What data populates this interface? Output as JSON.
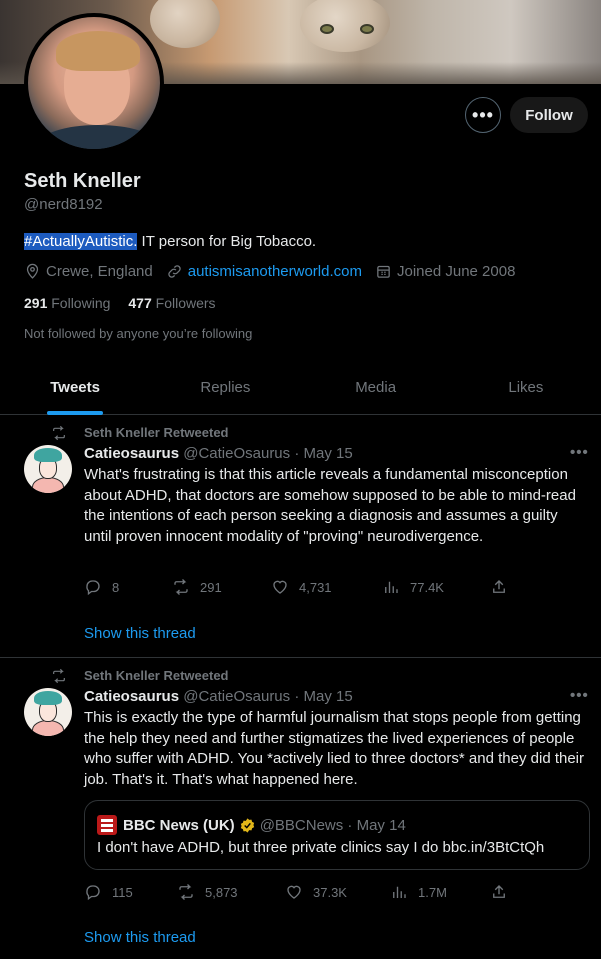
{
  "profile": {
    "name": "Seth Kneller",
    "handle": "@nerd8192",
    "bio_tag": "#ActuallyAutistic.",
    "bio_rest": " IT person for Big Tobacco.",
    "location": "Crewe, England",
    "website": "autismisanotherworld.com",
    "joined": "Joined June 2008",
    "following_count": "291",
    "following_label": "Following",
    "followers_count": "477",
    "followers_label": "Followers",
    "not_followed_note": "Not followed by anyone you’re following",
    "follow_button": "Follow",
    "more_button": "•••"
  },
  "tabs": [
    {
      "label": "Tweets",
      "active": true
    },
    {
      "label": "Replies",
      "active": false
    },
    {
      "label": "Media",
      "active": false
    },
    {
      "label": "Likes",
      "active": false
    }
  ],
  "tweets": [
    {
      "retweet_label": "Seth Kneller Retweeted",
      "author": "Catieosaurus",
      "meta": "@CatieOsaurus · May 15",
      "more": "•••",
      "text": "What's frustrating is that this article reveals a fundamental misconception about ADHD, that doctors are somehow supposed to be able to mind-read the intentions of each person seeking a diagnosis and assumes a guilty until proven innocent modality of \"proving\" neurodivergence.",
      "replies": "8",
      "retweets": "291",
      "likes": "4,731",
      "views": "77.4K",
      "show_thread": "Show this thread"
    },
    {
      "retweet_label": "Seth Kneller Retweeted",
      "author": "Catieosaurus",
      "meta": "@CatieOsaurus · May 15",
      "more": "•••",
      "text": "This is exactly the type of harmful journalism that stops people from getting the help they need and further stigmatizes the lived experiences of people who suffer with ADHD. You *actively lied to three doctors* and they did their job. That's it. That's what happened here.",
      "quote": {
        "author": "BBC News (UK)",
        "meta": "@BBCNews · May 14",
        "text": "I don't have ADHD, but three private clinics say I do bbc.in/3BtCtQh"
      },
      "replies": "115",
      "retweets": "5,873",
      "likes": "37.3K",
      "views": "1.7M",
      "show_thread": "Show this thread"
    }
  ],
  "colors": {
    "accent": "#1d9bf0",
    "background": "#000000",
    "text": "#e7e9ea",
    "muted": "#71767b",
    "border": "#2f3336",
    "verified_gold": "#e2b719"
  }
}
